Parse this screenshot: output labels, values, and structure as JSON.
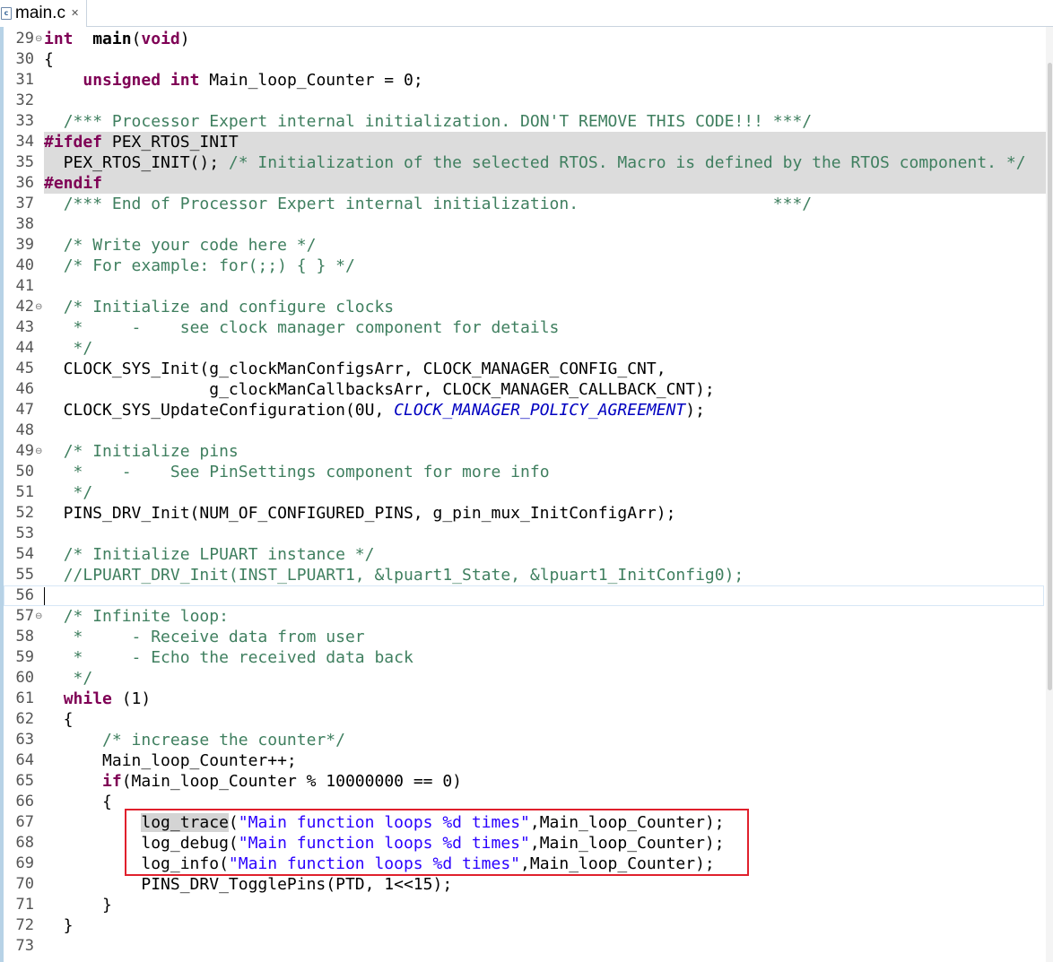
{
  "tab": {
    "label": "main.c",
    "close_glyph": "✕"
  },
  "highlight_box_color": "#e0202c",
  "editor_lines": [
    {
      "n": "29",
      "fold": true,
      "segs": [
        [
          "k",
          "int"
        ],
        [
          "",
          "  "
        ],
        [
          "b",
          "main"
        ],
        [
          "",
          "("
        ],
        [
          "k",
          "void"
        ],
        [
          "",
          ")"
        ]
      ]
    },
    {
      "n": "30",
      "segs": [
        [
          "",
          "{"
        ]
      ]
    },
    {
      "n": "31",
      "segs": [
        [
          "",
          "    "
        ],
        [
          "k",
          "unsigned int"
        ],
        [
          "",
          " Main_loop_Counter = 0;"
        ]
      ]
    },
    {
      "n": "32",
      "segs": []
    },
    {
      "n": "33",
      "segs": [
        [
          "",
          "  "
        ],
        [
          "c",
          "/*** Processor Expert internal initialization. DON'T REMOVE THIS CODE!!! ***/"
        ]
      ]
    },
    {
      "n": "34",
      "pp": true,
      "segs": [
        [
          "pk",
          "#ifdef"
        ],
        [
          "",
          " PEX_RTOS_INIT"
        ]
      ]
    },
    {
      "n": "35",
      "pp": true,
      "segs": [
        [
          "",
          "  PEX_RTOS_INIT(); "
        ],
        [
          "c",
          "/* Initialization of the selected RTOS. Macro is defined by the RTOS component. */"
        ]
      ]
    },
    {
      "n": "36",
      "pp": true,
      "segs": [
        [
          "pk",
          "#endif"
        ]
      ]
    },
    {
      "n": "37",
      "segs": [
        [
          "",
          "  "
        ],
        [
          "c",
          "/*** End of Processor Expert internal initialization.                    ***/"
        ]
      ]
    },
    {
      "n": "38",
      "segs": []
    },
    {
      "n": "39",
      "segs": [
        [
          "",
          "  "
        ],
        [
          "c",
          "/* Write your code here */"
        ]
      ]
    },
    {
      "n": "40",
      "segs": [
        [
          "",
          "  "
        ],
        [
          "c",
          "/* For example: for(;;) { } */"
        ]
      ]
    },
    {
      "n": "41",
      "segs": []
    },
    {
      "n": "42",
      "fold": true,
      "segs": [
        [
          "",
          "  "
        ],
        [
          "c",
          "/* Initialize and configure clocks"
        ]
      ]
    },
    {
      "n": "43",
      "segs": [
        [
          "",
          "  "
        ],
        [
          "c",
          " *     -    see clock manager component for details"
        ]
      ]
    },
    {
      "n": "44",
      "segs": [
        [
          "",
          "  "
        ],
        [
          "c",
          " */"
        ]
      ]
    },
    {
      "n": "45",
      "segs": [
        [
          "",
          "  CLOCK_SYS_Init(g_clockManConfigsArr, CLOCK_MANAGER_CONFIG_CNT,"
        ]
      ]
    },
    {
      "n": "46",
      "segs": [
        [
          "",
          "                 g_clockManCallbacksArr, CLOCK_MANAGER_CALLBACK_CNT);"
        ]
      ]
    },
    {
      "n": "47",
      "segs": [
        [
          "",
          "  CLOCK_SYS_UpdateConfiguration(0U, "
        ],
        [
          "e",
          "CLOCK_MANAGER_POLICY_AGREEMENT"
        ],
        [
          "",
          ");"
        ]
      ]
    },
    {
      "n": "48",
      "segs": []
    },
    {
      "n": "49",
      "fold": true,
      "segs": [
        [
          "",
          "  "
        ],
        [
          "c",
          "/* Initialize pins"
        ]
      ]
    },
    {
      "n": "50",
      "segs": [
        [
          "",
          "  "
        ],
        [
          "c",
          " *    -    See PinSettings component for more info"
        ]
      ]
    },
    {
      "n": "51",
      "segs": [
        [
          "",
          "  "
        ],
        [
          "c",
          " */"
        ]
      ]
    },
    {
      "n": "52",
      "segs": [
        [
          "",
          "  PINS_DRV_Init(NUM_OF_CONFIGURED_PINS, g_pin_mux_InitConfigArr);"
        ]
      ]
    },
    {
      "n": "53",
      "segs": []
    },
    {
      "n": "54",
      "segs": [
        [
          "",
          "  "
        ],
        [
          "c",
          "/* Initialize LPUART instance */"
        ]
      ]
    },
    {
      "n": "55",
      "segs": [
        [
          "",
          "  "
        ],
        [
          "c",
          "//LPUART_DRV_Init(INST_LPUART1, &lpuart1_State, &lpuart1_InitConfig0);"
        ]
      ]
    },
    {
      "n": "56",
      "cur": true,
      "segs": []
    },
    {
      "n": "57",
      "fold": true,
      "segs": [
        [
          "",
          "  "
        ],
        [
          "c",
          "/* Infinite loop:"
        ]
      ]
    },
    {
      "n": "58",
      "segs": [
        [
          "",
          "  "
        ],
        [
          "c",
          " *     - Receive data from user"
        ]
      ]
    },
    {
      "n": "59",
      "segs": [
        [
          "",
          "  "
        ],
        [
          "c",
          " *     - Echo the received data back"
        ]
      ]
    },
    {
      "n": "60",
      "segs": [
        [
          "",
          "  "
        ],
        [
          "c",
          " */"
        ]
      ]
    },
    {
      "n": "61",
      "segs": [
        [
          "",
          "  "
        ],
        [
          "k",
          "while"
        ],
        [
          "",
          " (1)"
        ]
      ]
    },
    {
      "n": "62",
      "segs": [
        [
          "",
          "  {"
        ]
      ]
    },
    {
      "n": "63",
      "segs": [
        [
          "",
          "      "
        ],
        [
          "c",
          "/* increase the counter*/"
        ]
      ]
    },
    {
      "n": "64",
      "segs": [
        [
          "",
          "      Main_loop_Counter++;"
        ]
      ]
    },
    {
      "n": "65",
      "segs": [
        [
          "",
          "      "
        ],
        [
          "k",
          "if"
        ],
        [
          "",
          "(Main_loop_Counter % 10000000 == 0)"
        ]
      ]
    },
    {
      "n": "66",
      "segs": [
        [
          "",
          "      {"
        ]
      ]
    },
    {
      "n": "67",
      "segs": [
        [
          "",
          "          "
        ],
        [
          "sel",
          "log_trace"
        ],
        [
          "",
          "("
        ],
        [
          "s",
          "\"Main function loops %d times\""
        ],
        [
          "",
          ",Main_loop_Counter);"
        ]
      ]
    },
    {
      "n": "68",
      "segs": [
        [
          "",
          "          log_debug("
        ],
        [
          "s",
          "\"Main function loops %d times\""
        ],
        [
          "",
          ",Main_loop_Counter);"
        ]
      ]
    },
    {
      "n": "69",
      "segs": [
        [
          "",
          "          log_info("
        ],
        [
          "s",
          "\"Main function loops %d times\""
        ],
        [
          "",
          ",Main_loop_Counter);"
        ]
      ]
    },
    {
      "n": "70",
      "segs": [
        [
          "",
          "          PINS_DRV_TogglePins(PTD, 1<<15);"
        ]
      ]
    },
    {
      "n": "71",
      "segs": [
        [
          "",
          "      }"
        ]
      ]
    },
    {
      "n": "72",
      "segs": [
        [
          "",
          "  }"
        ]
      ]
    },
    {
      "n": "73",
      "segs": []
    }
  ]
}
